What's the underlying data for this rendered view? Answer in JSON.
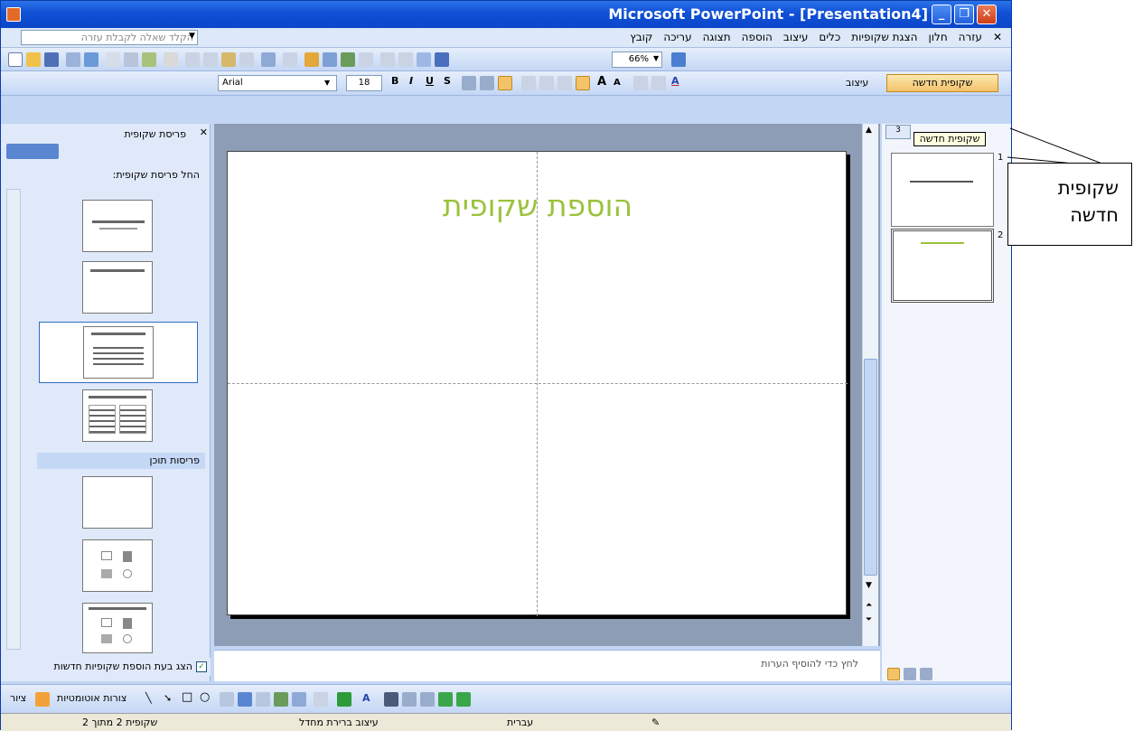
{
  "window": {
    "title": "Microsoft PowerPoint - [Presentation4]"
  },
  "menu": {
    "items": [
      "קובץ",
      "עריכה",
      "תצוגה",
      "הוספה",
      "עיצוב",
      "כלים",
      "הצגת שקופיות",
      "חלון",
      "עזרה"
    ],
    "help_placeholder": "הקלד שאלה לקבלת עזרה"
  },
  "toolbar": {
    "zoom": "66%",
    "font_name": "Arial",
    "font_size": "18",
    "design_label": "עיצוב",
    "new_slide_label": "שקופית חדשה"
  },
  "taskpane": {
    "title": "פריסת שקופית",
    "section_apply": "החל פריסת שקופית:",
    "section_content": "פריסות תוכן",
    "show_checkbox_label": "הצג בעת הוספת שקופיות חדשות"
  },
  "slide": {
    "title": "הוספת שקופית"
  },
  "notes": {
    "placeholder": "לחץ כדי להוסיף הערות"
  },
  "outline": {
    "tooltip": "שקופית חדשה",
    "tab_label": "3",
    "slides": [
      "1",
      "2"
    ]
  },
  "drawing": {
    "draw_label": "ציור",
    "autoshapes_label": "צורות אוטומטיות"
  },
  "status": {
    "slide_position": "שקופית 2 מתוך 2",
    "design": "עיצוב ברירת מחדל",
    "language": "עברית"
  },
  "callout": {
    "line1": "שקופית",
    "line2": "חדשה"
  },
  "colors": {
    "title_green": "#9bc23c",
    "titlebar_blue": "#0a46c8"
  }
}
